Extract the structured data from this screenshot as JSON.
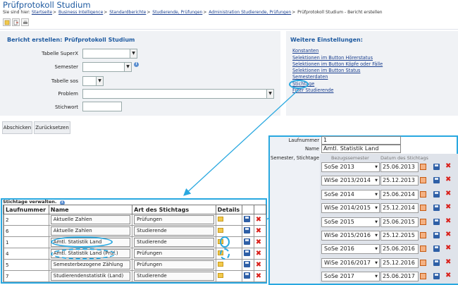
{
  "page": {
    "title": "Prüfprotokoll Studium",
    "crumb_prefix": "Sie sind hier:",
    "breadcrumbs": [
      "Startseite",
      "Business Intelligence",
      "Standardberichte",
      "Studierende, Prüfungen",
      "Administration Studierende, Prüfungen"
    ],
    "crumb_current": "Prüfprotokoll Studium - Bericht erstellen"
  },
  "form": {
    "heading": "Bericht erstellen: Prüfprotokoll Studium",
    "fields": {
      "tabelle_superx": "Tabelle SuperX",
      "semester": "Semester",
      "tabelle_sos": "Tabelle sos",
      "problem": "Problem",
      "stichwort": "Stichwort"
    },
    "info_icon": "i",
    "submit": "Abschicken",
    "reset": "Zurücksetzen"
  },
  "settings": {
    "heading": "Weitere Einstellungen:",
    "links": [
      "Konstanten",
      "Selektionen im Button Hörerstatus",
      "Selektionen im Button Köpfe oder Fälle",
      "Selektionen im Button Status",
      "Semesterdaten",
      "Stichtage",
      "Filter Studierende"
    ]
  },
  "stichtage_table": {
    "caption": "Stichtage verwalten.",
    "columns": [
      "Laufnummer",
      "Name",
      "Art des Stichtags",
      "Details"
    ],
    "rows": [
      {
        "nr": "2",
        "name": "Aktuelle Zahlen",
        "art": "Prüfungen"
      },
      {
        "nr": "6",
        "name": "Aktuelle Zahlen",
        "art": "Studierende"
      },
      {
        "nr": "1",
        "name": "Amtl. Statistik Land",
        "art": "Studierende"
      },
      {
        "nr": "4",
        "name": "Amtl. Statistik Land (Prüf.)",
        "art": "Prüfungen"
      },
      {
        "nr": "5",
        "name": "Semesterbezogene Zählung",
        "art": "Prüfungen"
      },
      {
        "nr": "7",
        "name": "Studierendenstatistik (Land)",
        "art": "Studierende"
      }
    ]
  },
  "detail": {
    "laufnummer_label": "Laufnummer",
    "laufnummer_value": "1",
    "name_label": "Name",
    "name_value": "Amtl. Statistik Land",
    "semester_label": "Semester, Stichtage",
    "col_semester": "Bezugssemester",
    "col_date": "Datum des Stichtags",
    "rows": [
      {
        "semester": "SoSe 2013",
        "date": "25.06.2013"
      },
      {
        "semester": "WiSe 2013/2014",
        "date": "25.12.2013"
      },
      {
        "semester": "SoSe 2014",
        "date": "25.06.2014"
      },
      {
        "semester": "WiSe 2014/2015",
        "date": "25.12.2014"
      },
      {
        "semester": "SoSe 2015",
        "date": "25.06.2015"
      },
      {
        "semester": "WiSe 2015/2016",
        "date": "25.12.2015"
      },
      {
        "semester": "SoSe 2016",
        "date": "25.06.2016"
      },
      {
        "semester": "WiSe 2016/2017",
        "date": "25.12.2016"
      },
      {
        "semester": "SoSe 2017",
        "date": "25.06.2017"
      }
    ]
  },
  "icons": [
    "new-document-icon",
    "export-icon",
    "print-icon",
    "info-icon",
    "edit-icon",
    "save-icon",
    "delete-icon",
    "calendar-icon",
    "arrow-icon"
  ],
  "colors": {
    "accent": "#1e5aa0",
    "highlight": "#29a8e0",
    "delete": "#d9211b"
  }
}
